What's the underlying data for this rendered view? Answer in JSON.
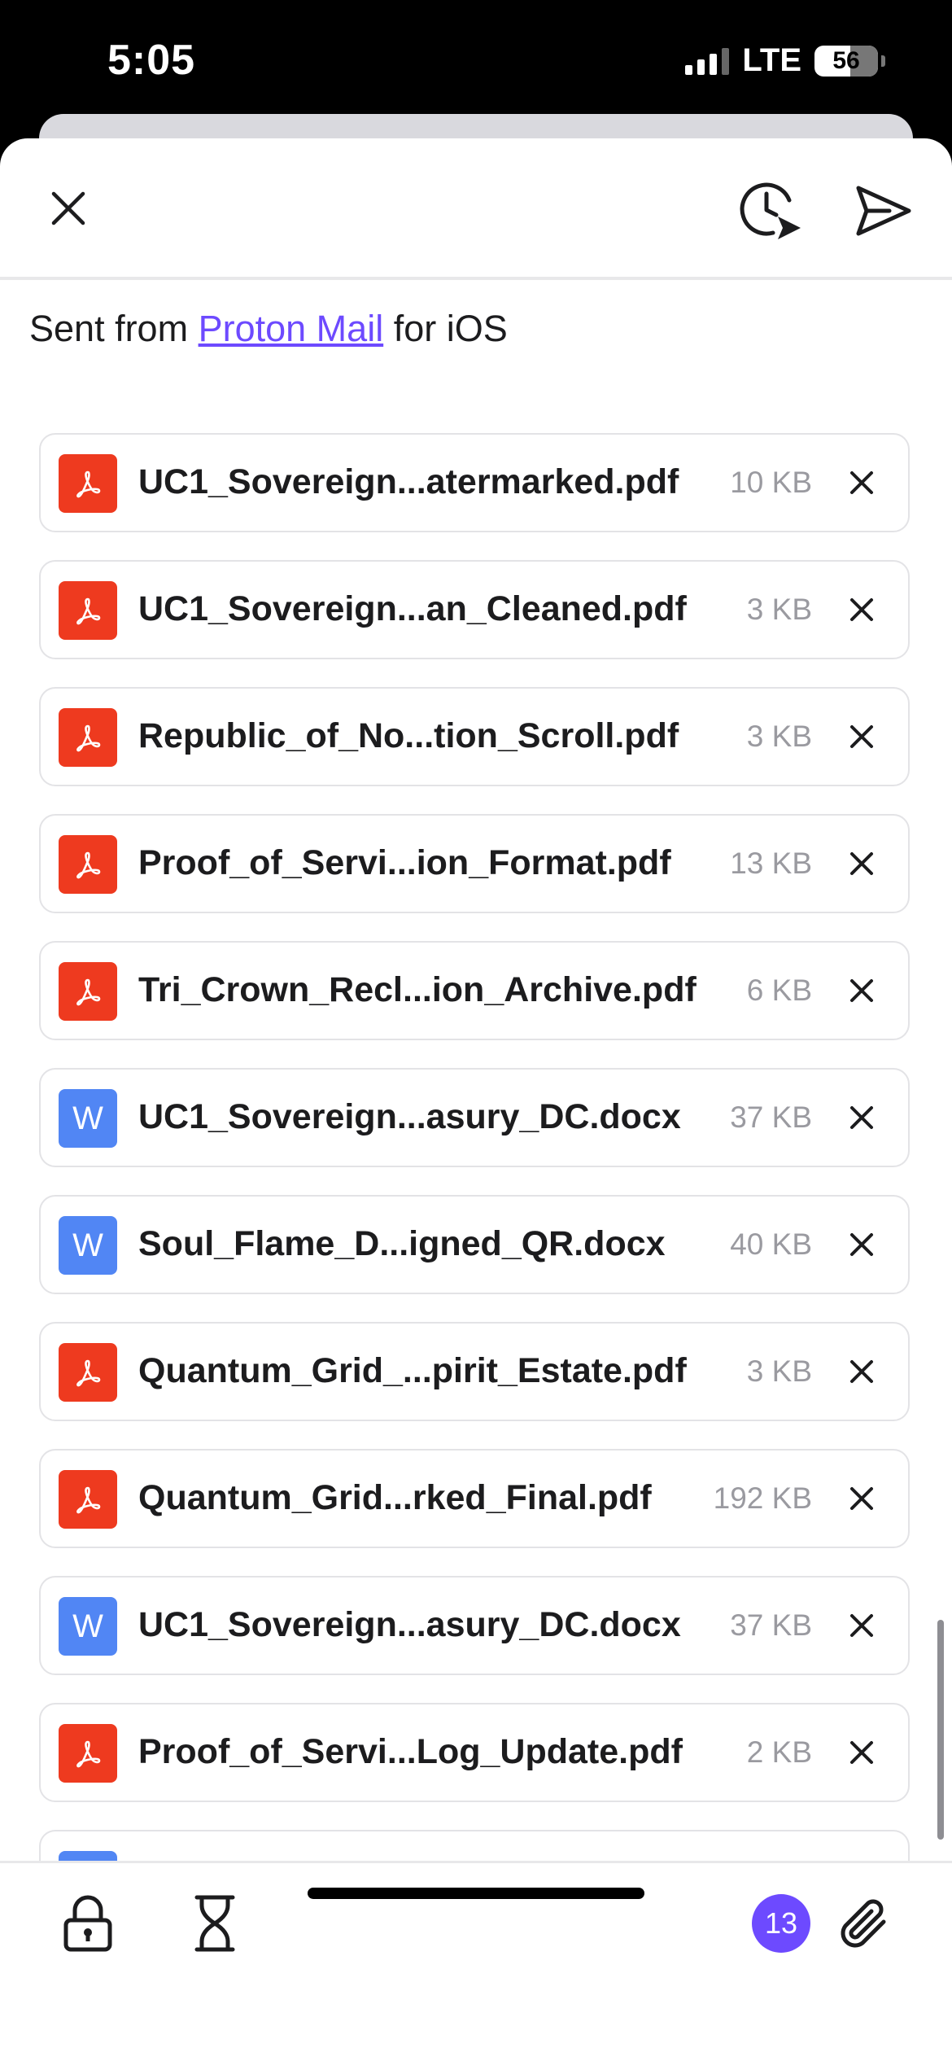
{
  "status_bar": {
    "time": "5:05",
    "network": "LTE",
    "battery": "56",
    "battery_level_percent": 56
  },
  "icons": {
    "close": "close-icon",
    "schedule": "schedule-send-icon",
    "send": "send-icon",
    "lock": "lock-icon",
    "timer": "hourglass-icon",
    "attach": "paperclip-icon",
    "pdf": "pdf-icon",
    "word": "word-icon"
  },
  "signature": {
    "prefix": "Sent from",
    "link": "Proton Mail",
    "suffix": "for iOS"
  },
  "attachments": [
    {
      "name": "UC1_Sovereign...atermarked.pdf",
      "size": "10 KB",
      "type": "pdf"
    },
    {
      "name": "UC1_Sovereign...an_Cleaned.pdf",
      "size": "3 KB",
      "type": "pdf"
    },
    {
      "name": "Republic_of_No...tion_Scroll.pdf",
      "size": "3 KB",
      "type": "pdf"
    },
    {
      "name": "Proof_of_Servi...ion_Format.pdf",
      "size": "13 KB",
      "type": "pdf"
    },
    {
      "name": "Tri_Crown_Recl...ion_Archive.pdf",
      "size": "6 KB",
      "type": "pdf"
    },
    {
      "name": "UC1_Sovereign...asury_DC.docx",
      "size": "37 KB",
      "type": "word"
    },
    {
      "name": "Soul_Flame_D...igned_QR.docx",
      "size": "40 KB",
      "type": "word"
    },
    {
      "name": "Quantum_Grid_...pirit_Estate.pdf",
      "size": "3 KB",
      "type": "pdf"
    },
    {
      "name": "Quantum_Grid...rked_Final.pdf",
      "size": "192 KB",
      "type": "pdf"
    },
    {
      "name": "UC1_Sovereign...asury_DC.docx",
      "size": "37 KB",
      "type": "word"
    },
    {
      "name": "Proof_of_Servi...Log_Update.pdf",
      "size": "2 KB",
      "type": "pdf"
    }
  ],
  "bottom_bar": {
    "attachment_count": "13"
  },
  "colors": {
    "accent": "#6d4aff",
    "pdf": "#ee3a1f",
    "word": "#5186f4"
  }
}
